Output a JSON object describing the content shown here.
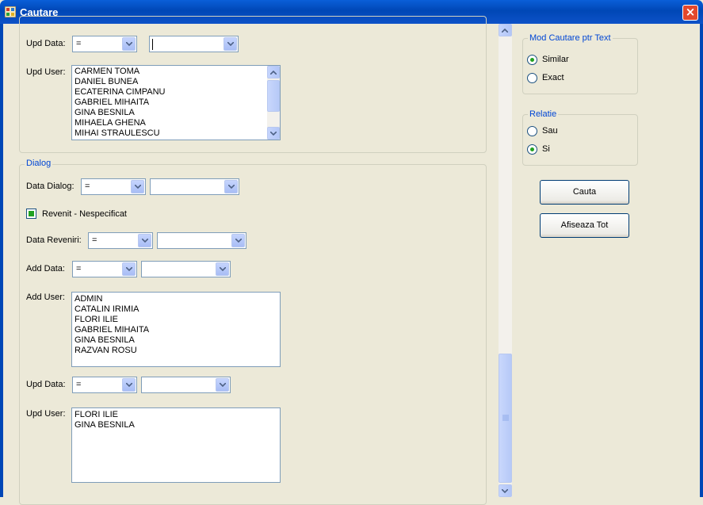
{
  "window": {
    "title": "Cautare"
  },
  "top_section": {
    "upd_data_label": "Upd Data:",
    "upd_data_op": "=",
    "upd_user_label": "Upd User:",
    "upd_user_items": [
      "CARMEN TOMA",
      "DANIEL BUNEA",
      "ECATERINA CIMPANU",
      "GABRIEL MIHAITA",
      "GINA BESNILA",
      "MIHAELA GHENA",
      "MIHAI STRAULESCU"
    ]
  },
  "dialog": {
    "title": "Dialog",
    "data_dialog_label": "Data Dialog:",
    "data_dialog_op": "=",
    "revenit_label": "Revenit - Nespecificat",
    "data_reveniri_label": "Data Reveniri:",
    "data_reveniri_op": "=",
    "add_data_label": "Add Data:",
    "add_data_op": "=",
    "add_user_label": "Add User:",
    "add_user_items": [
      "ADMIN",
      "CATALIN IRIMIA",
      "FLORI ILIE",
      "GABRIEL MIHAITA",
      "GINA BESNILA",
      "RAZVAN ROSU"
    ],
    "upd_data_label": "Upd Data:",
    "upd_data_op": "=",
    "upd_user_label": "Upd User:",
    "upd_user_items": [
      "FLORI ILIE",
      "GINA BESNILA"
    ]
  },
  "mod_cautare": {
    "title": "Mod Cautare ptr Text",
    "options": [
      "Similar",
      "Exact"
    ],
    "selected": "Similar"
  },
  "relatie": {
    "title": "Relatie",
    "options": [
      "Sau",
      "Si"
    ],
    "selected": "Si"
  },
  "buttons": {
    "cauta": "Cauta",
    "afiseaza_tot": "Afiseaza Tot"
  }
}
